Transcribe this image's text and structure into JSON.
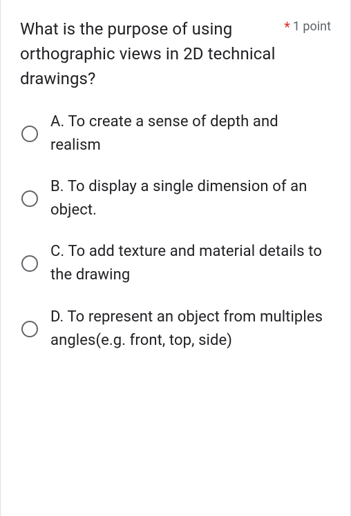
{
  "question": {
    "text": "What is the purpose of using orthographic views in 2D technical drawings?",
    "required_marker": "*",
    "points": "1 point"
  },
  "options": [
    {
      "label": "A. To create a sense of depth and realism"
    },
    {
      "label": "B. To display a single dimension of an object."
    },
    {
      "label": "C. To add texture and material details to the drawing"
    },
    {
      "label": "D. To represent an object from multiples angles(e.g. front, top, side)"
    }
  ]
}
